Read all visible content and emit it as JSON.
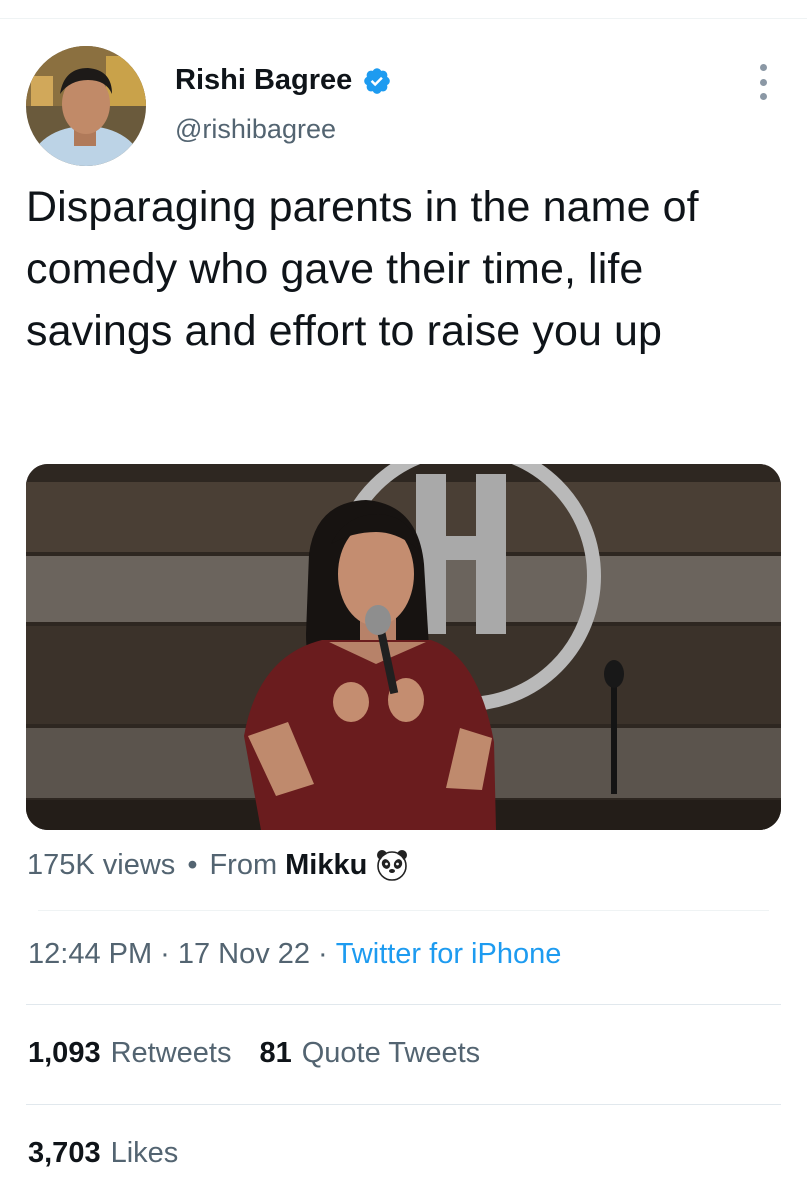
{
  "tweet": {
    "author": {
      "display_name": "Rishi Bagree",
      "handle": "@rishibagree",
      "verified": true
    },
    "text": "Disparaging parents in the name of comedy who gave their time, life savings and effort to raise you up",
    "media": {
      "type": "video-thumbnail"
    },
    "views": {
      "count": "175K views",
      "dot": "•",
      "from_label": "From",
      "source": "Mikku",
      "source_icon": "panda-face-icon"
    },
    "meta": {
      "time": "12:44 PM",
      "sep": "·",
      "date": "17 Nov 22",
      "client": "Twitter for iPhone"
    },
    "stats": {
      "retweets_count": "1,093",
      "retweets_label": "Retweets",
      "quotes_count": "81",
      "quotes_label": "Quote Tweets",
      "likes_count": "3,703",
      "likes_label": "Likes"
    }
  },
  "colors": {
    "text_primary": "#0f1419",
    "text_secondary": "#536471",
    "link": "#1d9bf0",
    "verified": "#1d9bf0",
    "divider": "#eff3f4"
  }
}
